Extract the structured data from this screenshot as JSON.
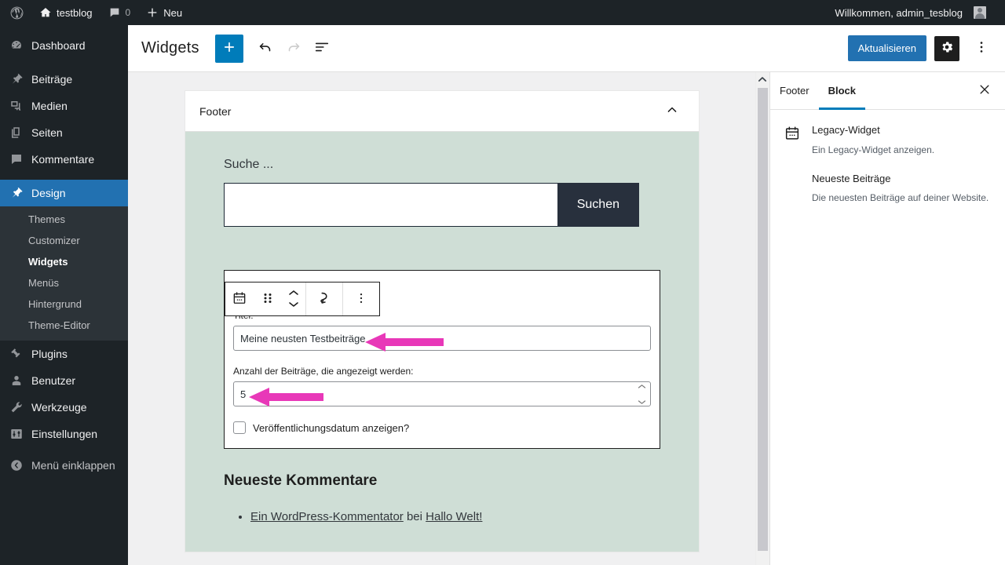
{
  "adminbar": {
    "site_name": "testblog",
    "comment_count": "0",
    "new_label": "Neu",
    "greeting": "Willkommen, admin_tesblog",
    "icons": {
      "logo": "wordpress-logo-icon",
      "home": "home-icon",
      "comments": "comment-bubble-icon",
      "new": "plus-icon",
      "avatar": "avatar"
    }
  },
  "sidebar": {
    "items": [
      {
        "label": "Dashboard",
        "icon": "dashboard-icon",
        "current": false
      },
      {
        "label": "Beiträge",
        "icon": "pin-icon",
        "current": false
      },
      {
        "label": "Medien",
        "icon": "media-icon",
        "current": false
      },
      {
        "label": "Seiten",
        "icon": "pages-icon",
        "current": false
      },
      {
        "label": "Kommentare",
        "icon": "comment-bubble-icon",
        "current": false
      },
      {
        "label": "Design",
        "icon": "appearance-brush-icon",
        "current": true
      },
      {
        "label": "Plugins",
        "icon": "plugin-icon",
        "current": false
      },
      {
        "label": "Benutzer",
        "icon": "users-icon",
        "current": false
      },
      {
        "label": "Werkzeuge",
        "icon": "wrench-icon",
        "current": false
      },
      {
        "label": "Einstellungen",
        "icon": "settings-sliders-icon",
        "current": false
      }
    ],
    "submenu": [
      {
        "label": "Themes",
        "active": false
      },
      {
        "label": "Customizer",
        "active": false
      },
      {
        "label": "Widgets",
        "active": true
      },
      {
        "label": "Menüs",
        "active": false
      },
      {
        "label": "Hintergrund",
        "active": false
      },
      {
        "label": "Theme-Editor",
        "active": false
      }
    ],
    "collapse": {
      "label": "Menü einklappen",
      "icon": "collapse-arrow-icon"
    }
  },
  "header": {
    "title": "Widgets",
    "add_block_icon": "plus-icon",
    "undo_icon": "undo-arrow-icon",
    "redo_icon": "redo-arrow-icon",
    "list_view_icon": "list-view-icon",
    "update_label": "Aktualisieren",
    "settings_icon": "gear-icon",
    "options_icon": "more-vertical-icon"
  },
  "canvas": {
    "widget_area": {
      "title": "Footer",
      "collapse_icon": "chevron-up-icon"
    },
    "search_block": {
      "label": "Suche ...",
      "input_value": "",
      "button_label": "Suchen"
    },
    "block_toolbar": {
      "block_type_icon": "legacy-widget-calendar-icon",
      "drag_handle_icon": "drag-dots-icon",
      "move_up_icon": "chevron-up-icon",
      "move_down_icon": "chevron-down-icon",
      "transform_icon": "swap-arrow-icon",
      "more_icon": "more-vertical-icon"
    },
    "legacy_widget": {
      "heading": "Neueste Beiträge",
      "title_label": "Titel:",
      "title_value": "Meine neusten Testbeiträge",
      "count_label": "Anzahl der Beiträge, die angezeigt werden:",
      "count_value": "5",
      "checkbox_label": "Veröffentlichungsdatum anzeigen?",
      "checkbox_checked": false,
      "spinner_up_icon": "chevron-up-icon",
      "spinner_down_icon": "chevron-down-icon"
    },
    "recent_comments": {
      "title": "Neueste Kommentare",
      "items": [
        {
          "author": "Ein WordPress-Kommentator",
          "connector": "bei",
          "post": "Hallo Welt!"
        }
      ]
    },
    "scrollbar": {
      "up_arrow_icon": "chevron-up-icon"
    }
  },
  "inspector": {
    "tabs": [
      {
        "label": "Footer",
        "active": false
      },
      {
        "label": "Block",
        "active": true
      }
    ],
    "close_icon": "close-icon",
    "block_icon": "legacy-widget-calendar-icon",
    "block_name": "Legacy-Widget",
    "block_description": "Ein Legacy-Widget anzeigen.",
    "widget_name": "Neueste Beiträge",
    "widget_description": "Die neuesten Beiträge auf deiner Website."
  },
  "annotations": {
    "arrow_color": "#e838b8",
    "title_arrow": "arrow-pointing-left-at-title-field",
    "count_arrow": "arrow-pointing-left-at-count-field"
  },
  "colors": {
    "admin_dark": "#1d2327",
    "admin_submenu": "#2c3338",
    "accent_blue": "#2271b1",
    "editor_blue": "#007cba",
    "canvas_bg": "#f0f0f1",
    "widget_preview_bg": "#cfded6",
    "search_button_bg": "#28303d",
    "annotation_pink": "#e838b8"
  }
}
